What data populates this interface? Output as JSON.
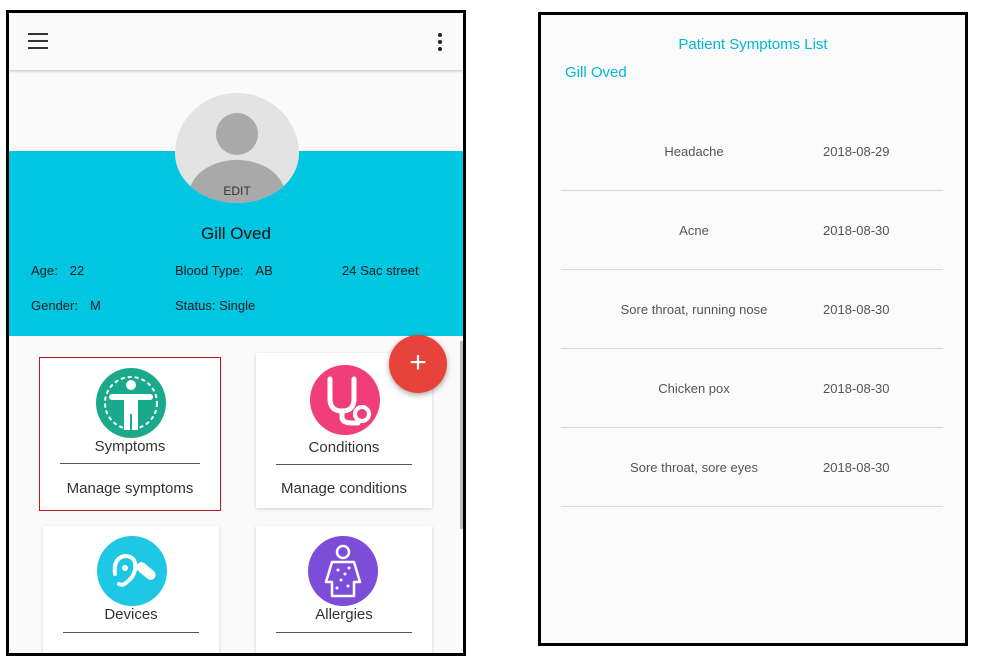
{
  "profile": {
    "avatar_edit": "EDIT",
    "name": "Gill Oved",
    "age_label": "Age:",
    "age_value": "22",
    "blood_label": "Blood Type:",
    "blood_value": "AB",
    "address": "24 Sac street",
    "gender_label": "Gender:",
    "gender_value": "M",
    "status_label": "Status:",
    "status_value": "Single"
  },
  "fab_label": "+",
  "cards": [
    {
      "title": "Symptoms",
      "sub": "Manage symptoms",
      "icon": "person-body-icon",
      "color": "#1ba98c"
    },
    {
      "title": "Conditions",
      "sub": "Manage conditions",
      "icon": "stethoscope-icon",
      "color": "#ef3e7a"
    },
    {
      "title": "Devices",
      "sub": "",
      "icon": "hearing-aid-icon",
      "color": "#1ec7e4"
    },
    {
      "title": "Allergies",
      "sub": "",
      "icon": "body-rash-icon",
      "color": "#7c4dd8"
    }
  ],
  "symptoms_list": {
    "title": "Patient Symptoms List",
    "patient": "Gill Oved",
    "rows": [
      {
        "symptom": "Headache",
        "date": "2018-08-29"
      },
      {
        "symptom": "Acne",
        "date": "2018-08-30"
      },
      {
        "symptom": "Sore throat, running nose",
        "date": "2018-08-30"
      },
      {
        "symptom": "Chicken pox",
        "date": "2018-08-30"
      },
      {
        "symptom": "Sore throat, sore eyes",
        "date": "2018-08-30"
      }
    ]
  },
  "colors": {
    "accent": "#00c6e2",
    "fab": "#e8433a",
    "list_text": "#00b7d4"
  }
}
